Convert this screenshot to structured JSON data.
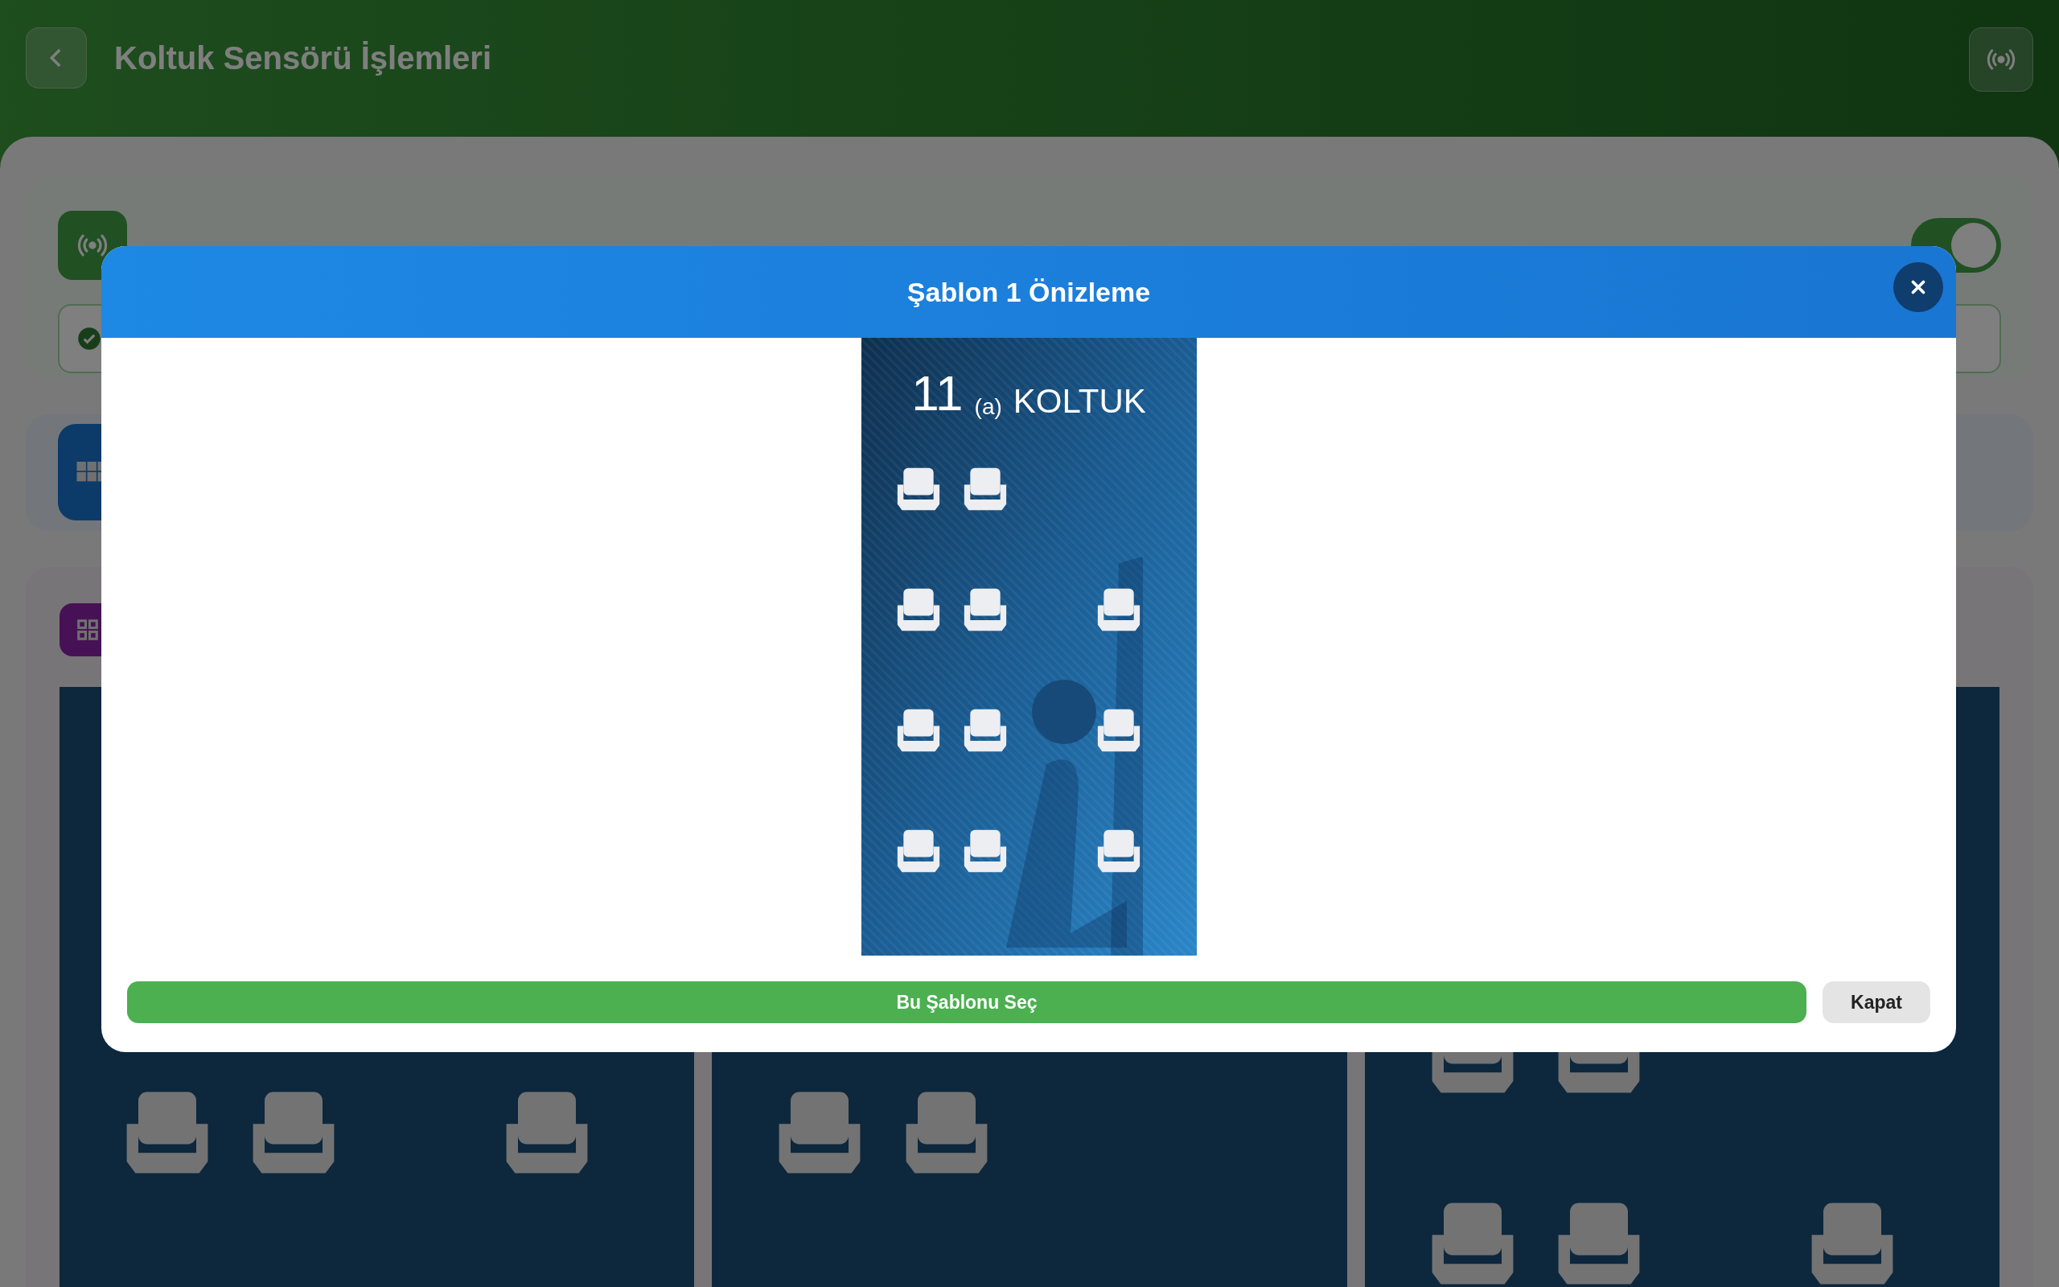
{
  "header": {
    "title": "Koltuk Sensörü İşlemleri"
  },
  "system_card": {
    "on": true
  },
  "templates": [
    {
      "rows": [
        [
          {
            "kind": "seat"
          },
          {
            "kind": "seat"
          },
          {
            "kind": "gap"
          },
          {
            "kind": "seat"
          }
        ]
      ]
    },
    {
      "rows": [
        [
          {
            "kind": "seat"
          },
          {
            "kind": "seat"
          },
          {
            "kind": "gap"
          },
          {
            "kind": "gap"
          }
        ]
      ]
    },
    {
      "rows": [
        [
          {
            "kind": "seat"
          },
          {
            "kind": "seat"
          },
          {
            "kind": "gap"
          },
          {
            "kind": "gap"
          }
        ],
        [
          {
            "kind": "seat"
          },
          {
            "kind": "seat"
          },
          {
            "kind": "gap"
          },
          {
            "kind": "seat"
          }
        ]
      ]
    }
  ],
  "modal": {
    "title": "Şablon 1 Önizleme",
    "preview": {
      "number": "11",
      "suffix": "(a)",
      "label": "KOLTUK",
      "rows": [
        [
          {
            "kind": "seat"
          },
          {
            "kind": "seat"
          },
          {
            "kind": "gap"
          },
          {
            "kind": "gap"
          }
        ],
        [
          {
            "kind": "seat"
          },
          {
            "kind": "seat"
          },
          {
            "kind": "gap"
          },
          {
            "kind": "seat"
          }
        ],
        [
          {
            "kind": "seat"
          },
          {
            "kind": "seat"
          },
          {
            "kind": "gap"
          },
          {
            "kind": "seat"
          }
        ],
        [
          {
            "kind": "seat"
          },
          {
            "kind": "seat"
          },
          {
            "kind": "gap"
          },
          {
            "kind": "seat"
          }
        ]
      ]
    },
    "primary_button": "Bu Şablonu Seç",
    "secondary_button": "Kapat"
  }
}
